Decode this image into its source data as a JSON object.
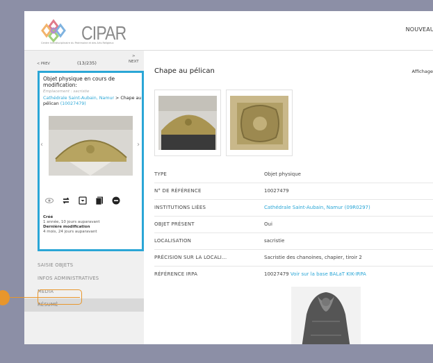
{
  "header": {
    "logo_text": "CIPAR",
    "logo_subtitle": "Centre Interdisciplinaire du Patrimoine et des Arts Religieux",
    "nav_new": "NOUVEAU"
  },
  "pager": {
    "prev": "< PREV",
    "count": "(13/235)",
    "next_arrow": ">",
    "next_label": "NEXT"
  },
  "object_card": {
    "title": "Objet physique en cours de modification:",
    "location_label": "Emplacement : sacristie",
    "path_link": "Cathédrale Saint-Aubain, Namur",
    "path_sep": " > ",
    "path_object": "Chape au pélican",
    "path_id": "(10027479)",
    "created_label": "Créé",
    "created_value": "1 année, 10 jours auparavant",
    "modified_label": "Dernière modification",
    "modified_value": "4 mois, 24 jours auparavant",
    "icons": [
      "eye-icon",
      "repeat-icon",
      "dropdown-box-icon",
      "copy-icon",
      "minus-circle-icon"
    ]
  },
  "sidebar_menu": {
    "items": [
      {
        "label": "SAISIE OBJETS"
      },
      {
        "label": "INFOS ADMINISTRATIVES"
      },
      {
        "label": "MEDIA"
      },
      {
        "label": "RÉSUMÉ",
        "active": true
      }
    ]
  },
  "main": {
    "heading": "Chape au pélican",
    "display_label": "Affichage",
    "properties": [
      {
        "key": "TYPE",
        "value": "Objet physique"
      },
      {
        "key": "N° DE RÉFÉRENCE",
        "value": "10027479"
      },
      {
        "key": "INSTITUTIONS LIÉES",
        "value": "Cathédrale Saint-Aubain, Namur (09R0297)",
        "link": true
      },
      {
        "key": "OBJET PRÉSENT",
        "value": "Oui"
      },
      {
        "key": "LOCALISATION",
        "value": "sacristie"
      },
      {
        "key": "PRÉCISION SUR LA LOCALI...",
        "value": "Sacristie des chanoines, chapier, tiroir 2"
      },
      {
        "key": "RÉFÉRENCE IRPA",
        "value": "10027479",
        "link_text": "Voir sur la base BALaT KIK-IRPA"
      }
    ]
  },
  "colors": {
    "accent": "#2aa6d6",
    "highlight": "#e8962c",
    "background": "#8c8fa6"
  }
}
